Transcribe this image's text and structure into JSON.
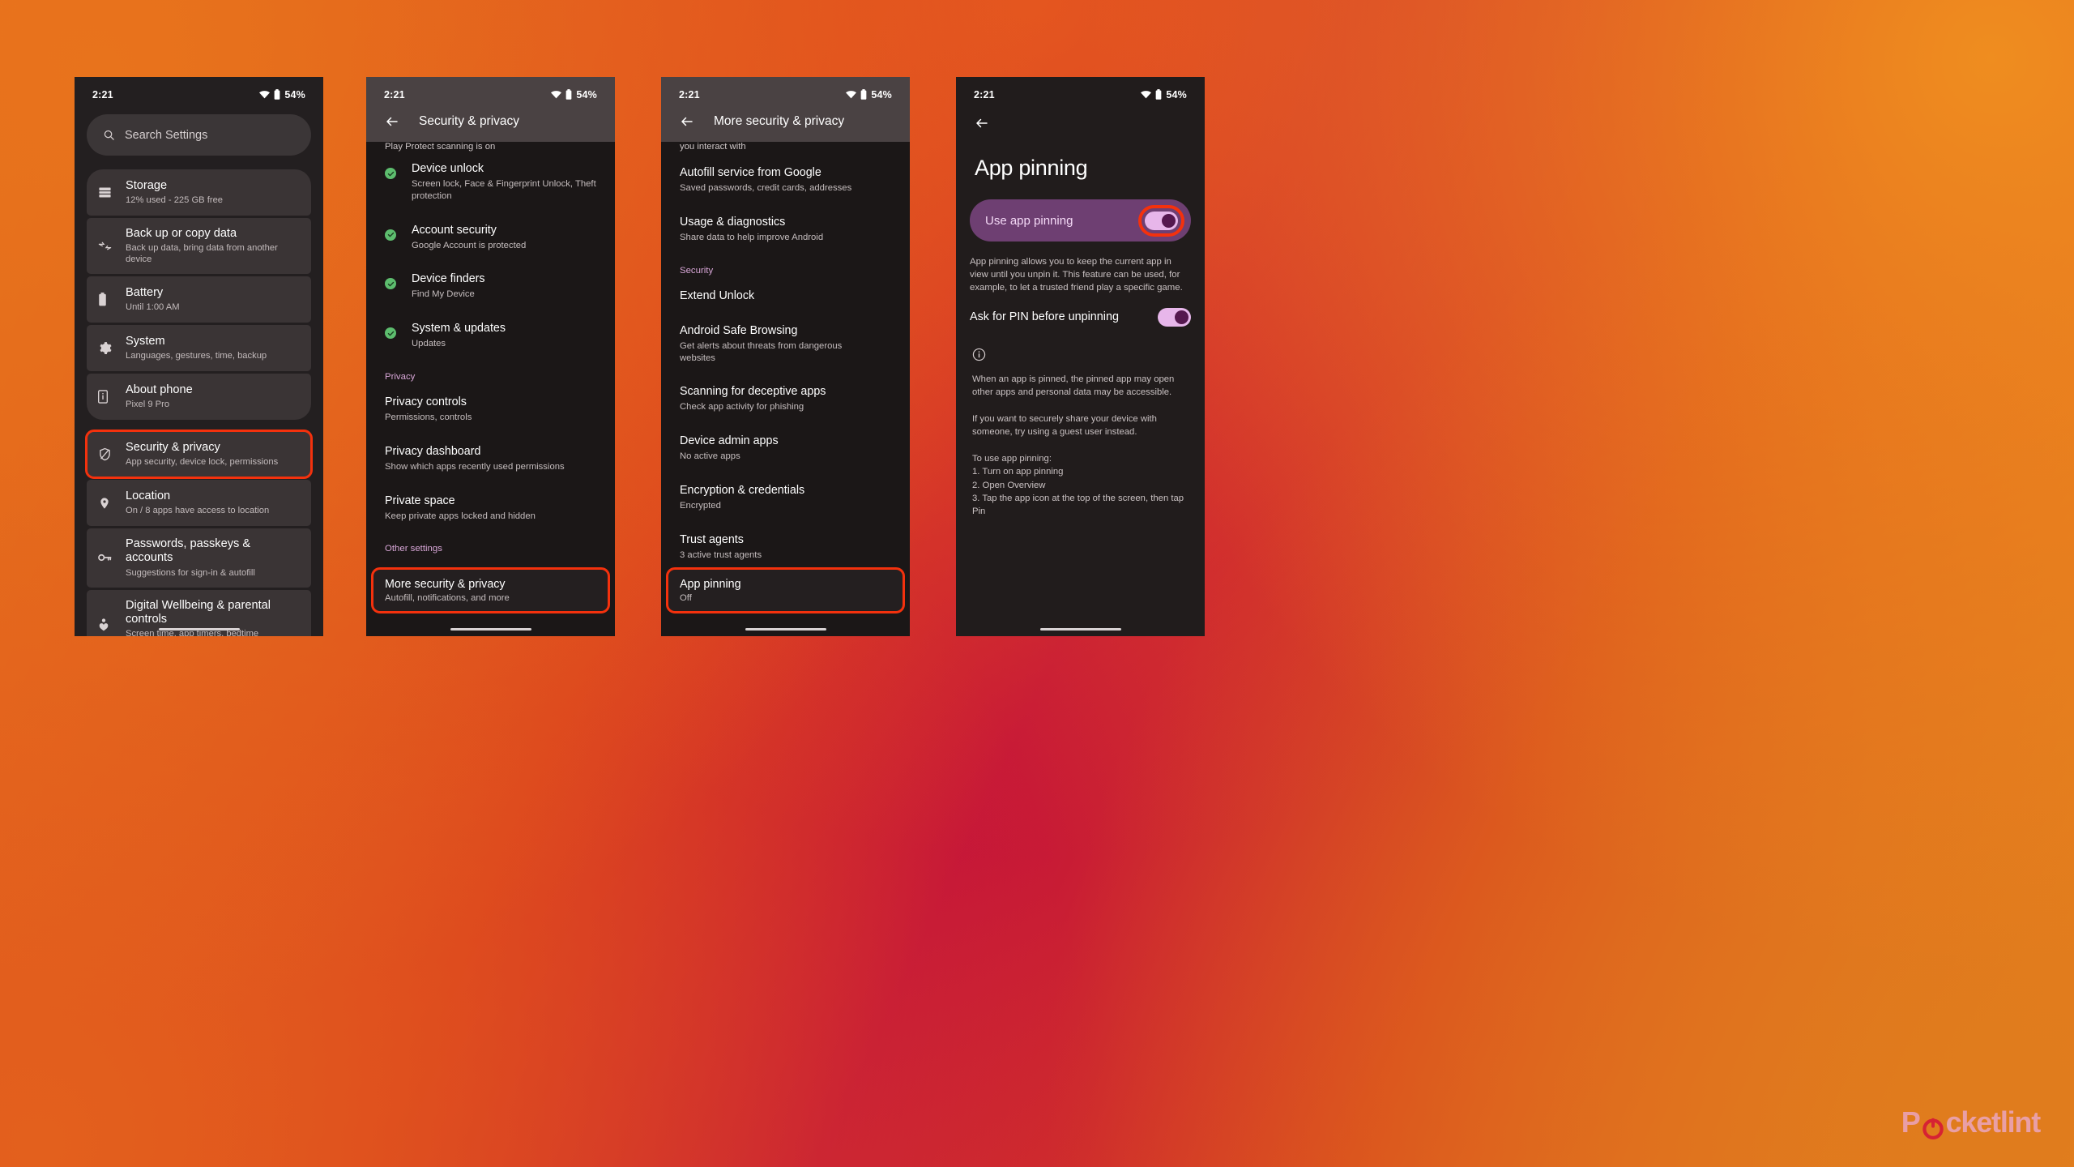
{
  "status_bar": {
    "time": "2:21",
    "battery": "54%",
    "wifi_icon": "wifi-icon",
    "battery_icon": "battery-icon"
  },
  "watermark": {
    "part1": "P",
    "part2": "cketlint"
  },
  "phone1": {
    "search": {
      "placeholder": "Search Settings",
      "icon": "search-icon"
    },
    "items": [
      {
        "icon": "storage-icon",
        "title": "Storage",
        "subtitle": "12% used - 225 GB free"
      },
      {
        "icon": "transfer-icon",
        "title": "Back up or copy data",
        "subtitle": "Back up data, bring data from another device"
      },
      {
        "icon": "battery-icon",
        "title": "Battery",
        "subtitle": "Until 1:00 AM"
      },
      {
        "icon": "gear-icon",
        "title": "System",
        "subtitle": "Languages, gestures, time, backup"
      },
      {
        "icon": "phone-info-icon",
        "title": "About phone",
        "subtitle": "Pixel 9 Pro"
      },
      {
        "icon": "shield-icon",
        "title": "Security & privacy",
        "subtitle": "App security, device lock, permissions",
        "highlighted": true
      },
      {
        "icon": "location-pin-icon",
        "title": "Location",
        "subtitle": "On / 8 apps have access to location"
      },
      {
        "icon": "key-icon",
        "title": "Passwords, passkeys & accounts",
        "subtitle": "Suggestions for sign-in & autofill"
      },
      {
        "icon": "wellbeing-icon",
        "title": "Digital Wellbeing & parental controls",
        "subtitle": "Screen time, app timers, bedtime schedules"
      }
    ]
  },
  "phone2": {
    "header": {
      "title": "Security & privacy",
      "back_icon": "back-arrow-icon"
    },
    "cut_text": "Play Protect scanning is on",
    "items": [
      {
        "check": true,
        "title": "Device unlock",
        "subtitle": "Screen lock, Face & Fingerprint Unlock, Theft protection"
      },
      {
        "check": true,
        "title": "Account security",
        "subtitle": "Google Account is protected"
      },
      {
        "check": true,
        "title": "Device finders",
        "subtitle": "Find My Device"
      },
      {
        "check": true,
        "title": "System & updates",
        "subtitle": "Updates"
      }
    ],
    "section_privacy": "Privacy",
    "privacy_items": [
      {
        "title": "Privacy controls",
        "subtitle": "Permissions, controls"
      },
      {
        "title": "Privacy dashboard",
        "subtitle": "Show which apps recently used permissions"
      },
      {
        "title": "Private space",
        "subtitle": "Keep private apps locked and hidden"
      }
    ],
    "section_other": "Other settings",
    "other_item": {
      "title": "More security & privacy",
      "subtitle": "Autofill, notifications, and more",
      "highlighted": true
    }
  },
  "phone3": {
    "header": {
      "title": "More security & privacy",
      "back_icon": "back-arrow-icon"
    },
    "cut_text": "you interact with",
    "items": [
      {
        "title": "Autofill service from Google",
        "subtitle": "Saved passwords, credit cards, addresses"
      },
      {
        "title": "Usage & diagnostics",
        "subtitle": "Share data to help improve Android"
      }
    ],
    "section_security": "Security",
    "security_items": [
      {
        "title": "Extend Unlock",
        "subtitle": ""
      },
      {
        "title": "Android Safe Browsing",
        "subtitle": "Get alerts about threats from dangerous websites"
      },
      {
        "title": "Scanning for deceptive apps",
        "subtitle": "Check app activity for phishing"
      },
      {
        "title": "Device admin apps",
        "subtitle": "No active apps"
      },
      {
        "title": "Encryption & credentials",
        "subtitle": "Encrypted"
      },
      {
        "title": "Trust agents",
        "subtitle": "3 active trust agents"
      }
    ],
    "highlight_item": {
      "title": "App pinning",
      "subtitle": "Off",
      "highlighted": true
    }
  },
  "phone4": {
    "back_icon": "back-arrow-icon",
    "title": "App pinning",
    "toggle": {
      "label": "Use app pinning",
      "state": "on",
      "highlighted": true
    },
    "description": "App pinning allows you to keep the current app in view until you unpin it. This feature can be used, for example, to let a trusted friend play a specific game.",
    "pin_row": {
      "label": "Ask for PIN before unpinning",
      "state": "on"
    },
    "info_icon": "info-icon",
    "notes": "When an app is pinned, the pinned app may open other apps and personal data may be accessible.\n\nIf you want to securely share your device with someone, try using a guest user instead.\n\nTo use app pinning:\n1. Turn on app pinning\n2. Open Overview\n3. Tap the app icon at the top of the screen, then tap Pin"
  },
  "colors": {
    "highlight": "#f4310d",
    "accent_purple": "#d9a7d8",
    "check_green": "#5dbd6e"
  }
}
